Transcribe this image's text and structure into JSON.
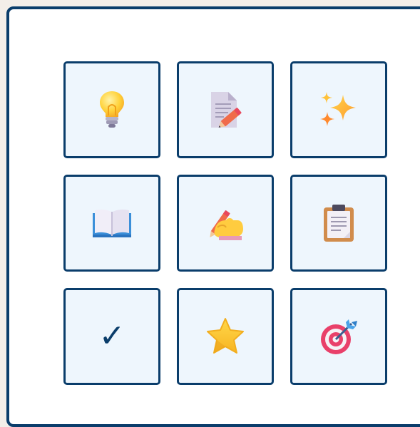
{
  "grid": {
    "tiles": [
      {
        "icon": "lightbulb-icon",
        "glyph": ""
      },
      {
        "icon": "document-pencil-icon",
        "glyph": ""
      },
      {
        "icon": "sparkles-icon",
        "glyph": ""
      },
      {
        "icon": "open-book-icon",
        "glyph": ""
      },
      {
        "icon": "writing-hand-icon",
        "glyph": ""
      },
      {
        "icon": "clipboard-icon",
        "glyph": ""
      },
      {
        "icon": "checkmark-icon",
        "glyph": "✓"
      },
      {
        "icon": "star-icon",
        "glyph": ""
      },
      {
        "icon": "target-dart-icon",
        "glyph": ""
      }
    ]
  },
  "colors": {
    "border": "#0a3d6b",
    "tile_bg": "#eef6fd",
    "page_bg": "#f3eee9",
    "panel_bg": "#ffffff"
  }
}
